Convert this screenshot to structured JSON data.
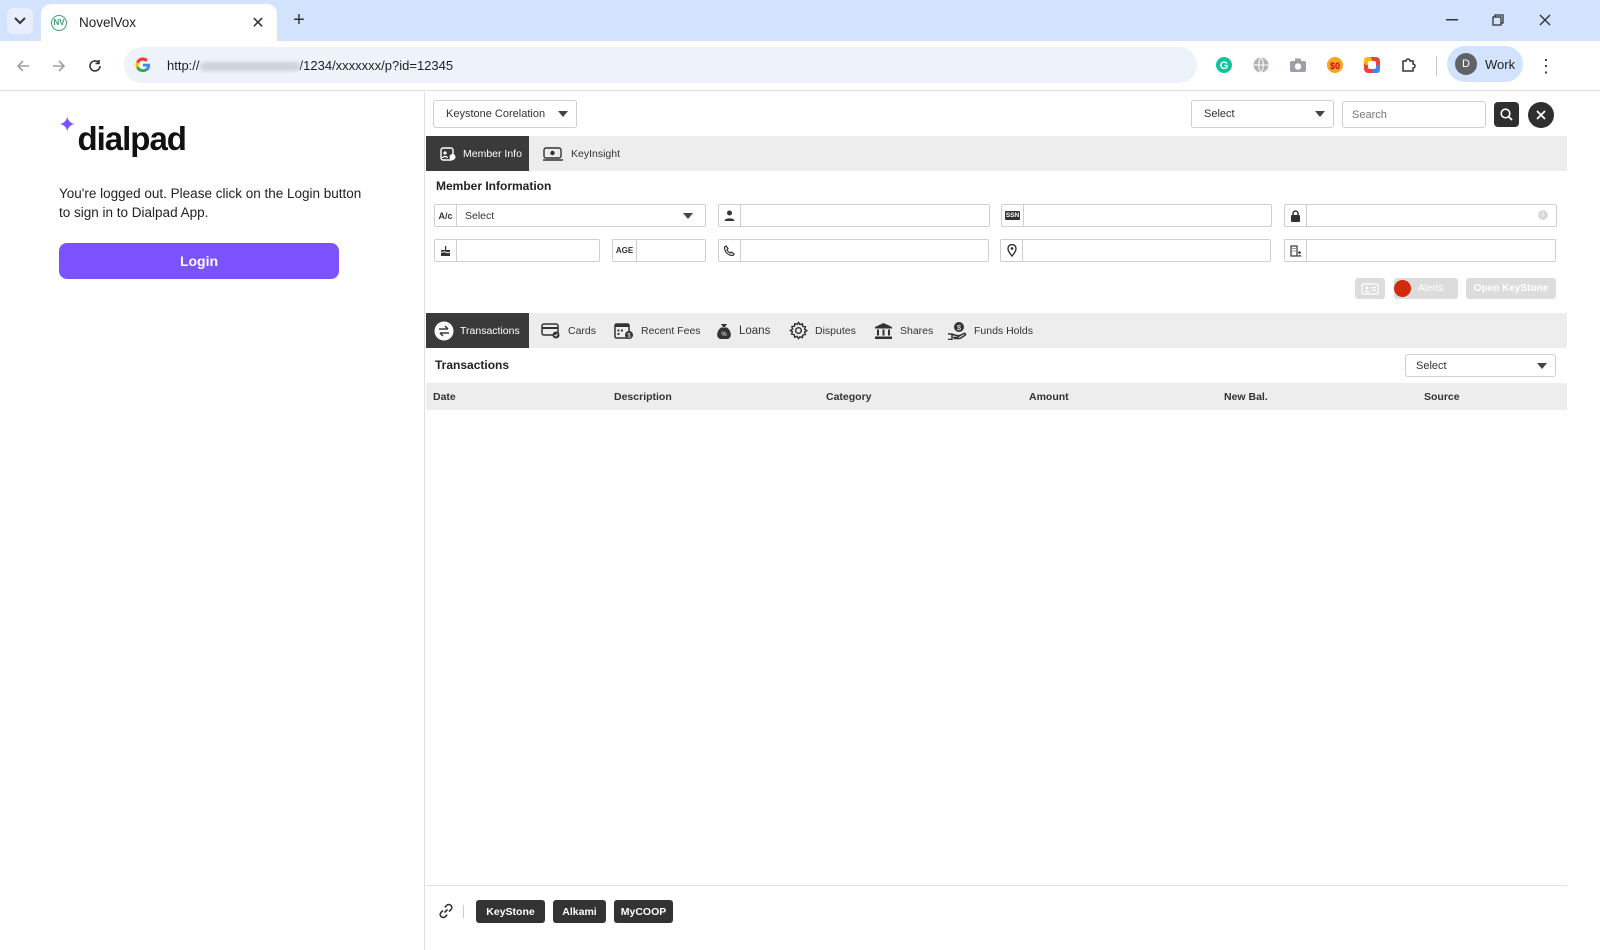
{
  "browser": {
    "tab_title": "NovelVox",
    "url_prefix": "http://",
    "url_suffix": "/1234/xxxxxxx/p?id=12345",
    "profile_initial": "D",
    "profile_label": "Work",
    "icons": [
      "tab-list-icon",
      "close-icon",
      "plus-icon",
      "minimize-icon",
      "restore-icon",
      "close-window-icon",
      "back-arrow-icon",
      "forward-arrow-icon",
      "reload-icon",
      "google-icon",
      "grammarly-icon",
      "globe-icon",
      "camera-icon",
      "extension-icon",
      "color-picker-icon",
      "puzzle-icon",
      "kebab-menu-icon"
    ]
  },
  "dialpad": {
    "logo_text": "dialpad",
    "message": "You're logged out. Please click on the Login button to sign in to Dialpad App.",
    "login_label": "Login",
    "brand_color": "#7c52ff"
  },
  "novelvox": {
    "header": {
      "source_select": "Keystone Corelation",
      "type_select": "Select",
      "search_placeholder": "Search"
    },
    "top_tabs": [
      {
        "label": "Member Info",
        "active": true
      },
      {
        "label": "KeyInsight",
        "active": false
      }
    ],
    "member_info": {
      "title": "Member Information",
      "account_label": "A/c",
      "account_select": "Select",
      "ssn_label": "SSN",
      "age_label": "AGE"
    },
    "actions": {
      "alerts_label": "Alerts",
      "open_keystone_label": "Open KeyStone",
      "alert_color": "#d42a0c"
    },
    "bottom_tabs": [
      {
        "label": "Transactions",
        "active": true
      },
      {
        "label": "Cards",
        "active": false
      },
      {
        "label": "Recent Fees",
        "active": false
      },
      {
        "label": "Loans",
        "active": false
      },
      {
        "label": "Disputes",
        "active": false
      },
      {
        "label": "Shares",
        "active": false
      },
      {
        "label": "Funds Holds",
        "active": false
      }
    ],
    "transactions": {
      "title": "Transactions",
      "filter_select": "Select",
      "columns": [
        "Date",
        "Description",
        "Category",
        "Amount",
        "New Bal.",
        "Source"
      ]
    },
    "footer_links": [
      "KeyStone",
      "Alkami",
      "MyCOOP"
    ]
  }
}
